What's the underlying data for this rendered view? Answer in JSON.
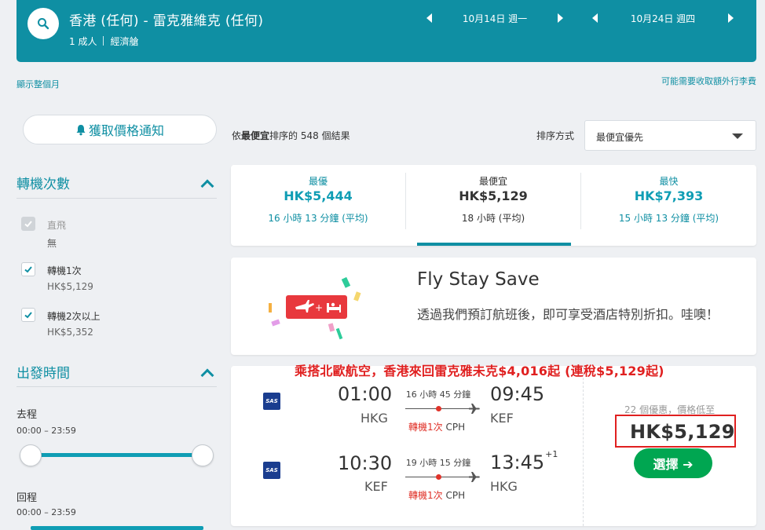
{
  "header": {
    "route": "香港 (任何) - 雷克雅維克 (任何)",
    "passengers": "1 成人",
    "cabin": "經濟艙",
    "depart_date": "10月14日 週一",
    "return_date": "10月24日 週四"
  },
  "links": {
    "show_month": "顯示整個月",
    "baggage_fees": "可能需要收取額外行李費"
  },
  "sidebar": {
    "price_alert_label": "獲取價格通知",
    "stops_title": "轉機次數",
    "stops": [
      {
        "label": "直飛",
        "sub": "無",
        "checked": true,
        "disabled": true
      },
      {
        "label": "轉機1次",
        "sub": "HK$5,129",
        "checked": true,
        "disabled": false
      },
      {
        "label": "轉機2次以上",
        "sub": "HK$5,352",
        "checked": true,
        "disabled": false
      }
    ],
    "departure_title": "出發時間",
    "outbound_label": "去程",
    "outbound_range": "00:00 – 23:59",
    "return_label": "回程",
    "return_range": "00:00 – 23:59"
  },
  "results": {
    "count_prefix": "依",
    "count_bold": "最便宜",
    "count_suffix": "排序的 548 個結果",
    "sort_label": "排序方式",
    "sort_value": "最便宜優先"
  },
  "tabs": [
    {
      "label": "最優",
      "price": "HK$5,444",
      "duration": "16 小時 13 分鐘 (平均)"
    },
    {
      "label": "最便宜",
      "price": "HK$5,129",
      "duration": "18 小時 (平均)"
    },
    {
      "label": "最快",
      "price": "HK$7,393",
      "duration": "15 小時 13 分鐘 (平均)"
    }
  ],
  "promo": {
    "title": "Fly Stay Save",
    "text": "透過我們預訂航班後，即可享受酒店特別折扣。哇噢！"
  },
  "annotation": "乘搭北歐航空，香港來回雷克雅未克$4,016起 (連稅$5,129起)",
  "flight": {
    "airline_logo": "SAS",
    "outbound": {
      "dep_time": "01:00",
      "dep_code": "HKG",
      "duration": "16 小時 45 分鐘",
      "stop_text": "轉機1次",
      "stop_airport": "CPH",
      "arr_time": "09:45",
      "arr_code": "KEF",
      "day_offset": ""
    },
    "inbound": {
      "dep_time": "10:30",
      "dep_code": "KEF",
      "duration": "19 小時 15 分鐘",
      "stop_text": "轉機1次",
      "stop_airport": "CPH",
      "arr_time": "13:45",
      "arr_code": "HKG",
      "day_offset": "+1"
    },
    "deals_text": "22 個優惠，價格低至",
    "price": "HK$5,129",
    "select_label": "選擇 ➔"
  },
  "colors": {
    "brand": "#0f8fa3",
    "select_green": "#00a651",
    "annotation_red": "#e02020"
  }
}
